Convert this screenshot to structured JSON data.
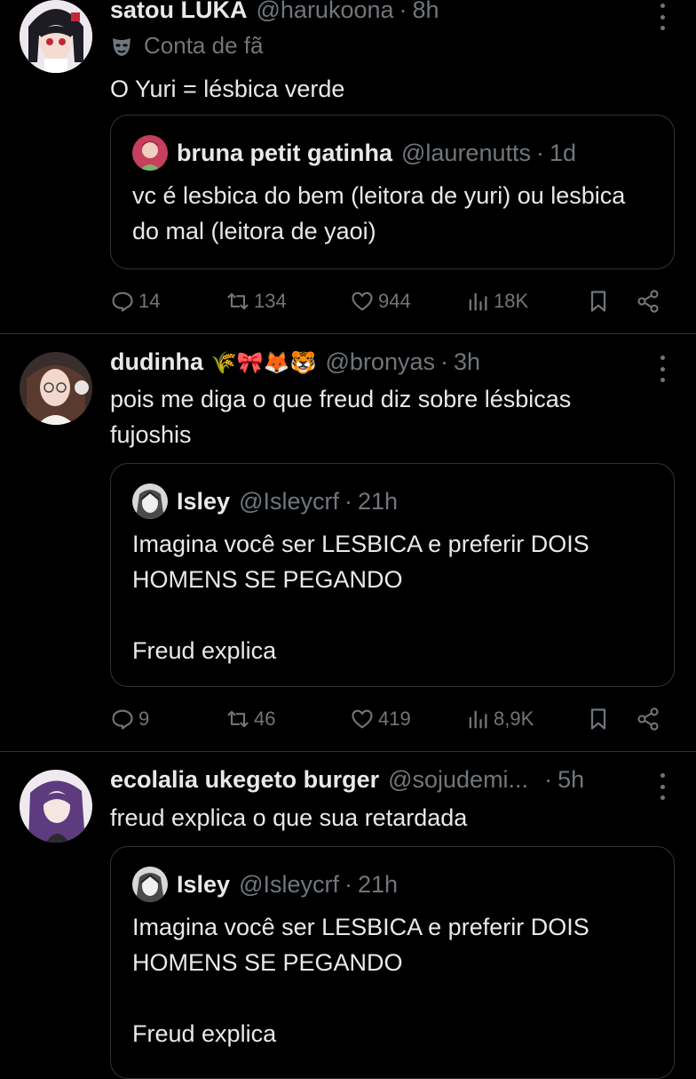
{
  "posts": [
    {
      "name": "satou LUKA",
      "handle": "@harukoona",
      "time": "8h",
      "badge": "Conta de fã",
      "badge_icon": "mask-icon",
      "text": "O Yuri = lésbica verde",
      "quote": {
        "name": "bruna petit gatinha",
        "handle": "@laurenutts",
        "time": "1d",
        "text": "vc é lesbica do bem (leitora de yuri) ou lesbica do mal (leitora de yaoi)"
      },
      "stats": {
        "replies": "14",
        "reposts": "134",
        "likes": "944",
        "views": "18K"
      }
    },
    {
      "name": "dudinha",
      "emoji": "🌾🎀🦊🐯",
      "handle": "@bronyas",
      "time": "3h",
      "text": "pois me diga o que freud diz sobre lésbicas fujoshis",
      "quote": {
        "name": "Isley",
        "handle": "@Isleycrf",
        "time": "21h",
        "text_line1": "Imagina você ser LESBICA e preferir DOIS HOMENS SE PEGANDO",
        "text_line2": "Freud explica"
      },
      "stats": {
        "replies": "9",
        "reposts": "46",
        "likes": "419",
        "views": "8,9K"
      }
    },
    {
      "name": "ecolalia ukegeto burger",
      "handle": "@sojudemi...",
      "time": "5h",
      "text": "freud explica o que sua retardada",
      "quote": {
        "name": "Isley",
        "handle": "@Isleycrf",
        "time": "21h",
        "text_line1": "Imagina você ser LESBICA e preferir DOIS HOMENS SE PEGANDO",
        "text_line2": "Freud explica"
      }
    }
  ],
  "separator": "·",
  "colors": {
    "background": "#000000",
    "text": "#e7e9ea",
    "muted": "#71767b",
    "border": "#2f3336"
  }
}
